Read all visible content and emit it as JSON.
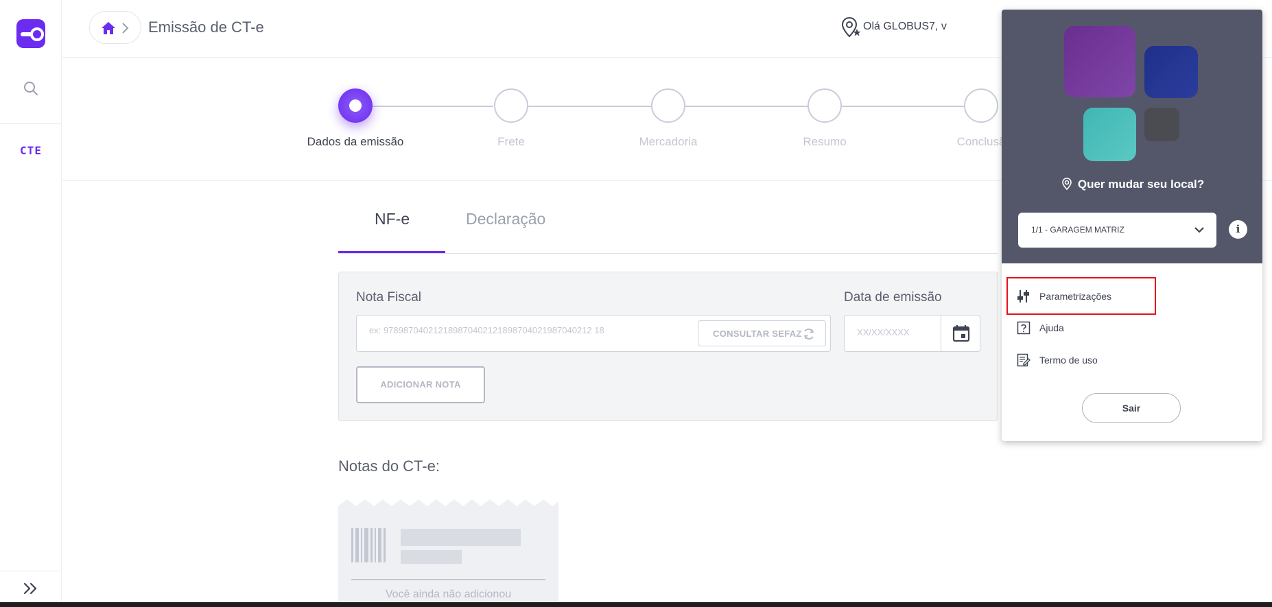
{
  "sidebar": {
    "logo_icon": "brand-logo-icon",
    "search_icon": "search-icon",
    "module_label": "CTE",
    "expand_icon": "double-chevron-right-icon"
  },
  "header": {
    "home_icon": "home-icon",
    "title": "Emissão de CT-e",
    "greeting": "Olá GLOBUS7, v"
  },
  "stepper": {
    "steps": [
      {
        "label": "Dados da emissão",
        "active": true
      },
      {
        "label": "Frete",
        "active": false
      },
      {
        "label": "Mercadoria",
        "active": false
      },
      {
        "label": "Resumo",
        "active": false
      },
      {
        "label": "Conclusã",
        "active": false
      }
    ]
  },
  "tabs": [
    {
      "label": "NF-e",
      "active": true
    },
    {
      "label": "Declaração",
      "active": false
    }
  ],
  "form": {
    "nota_fiscal_label": "Nota Fiscal",
    "nota_fiscal_placeholder": "ex: 978987040212189870402121898704021987040212 18",
    "consultar_label": "CONSULTAR SEFAZ",
    "data_emissao_label": "Data de emissão",
    "data_placeholder": "XX/XX/XXXX",
    "add_button": "ADICIONAR NOTA"
  },
  "notas": {
    "title": "Notas do CT-e:",
    "empty_text": "Você ainda não adicionou"
  },
  "dropdown": {
    "change_location": "Quer mudar seu local?",
    "selected_location": "1/1 - GARAGEM MATRIZ",
    "info_label": "i",
    "menu": [
      {
        "label": "Parametrizações",
        "icon": "sliders-icon",
        "highlighted": true
      },
      {
        "label": "Ajuda",
        "icon": "help-icon",
        "highlighted": false
      },
      {
        "label": "Termo de uso",
        "icon": "document-edit-icon",
        "highlighted": false
      }
    ],
    "logout": "Sair"
  },
  "colors": {
    "accent": "#6c2bf0",
    "panel_dark": "#545769",
    "highlight": "#e5101c"
  }
}
